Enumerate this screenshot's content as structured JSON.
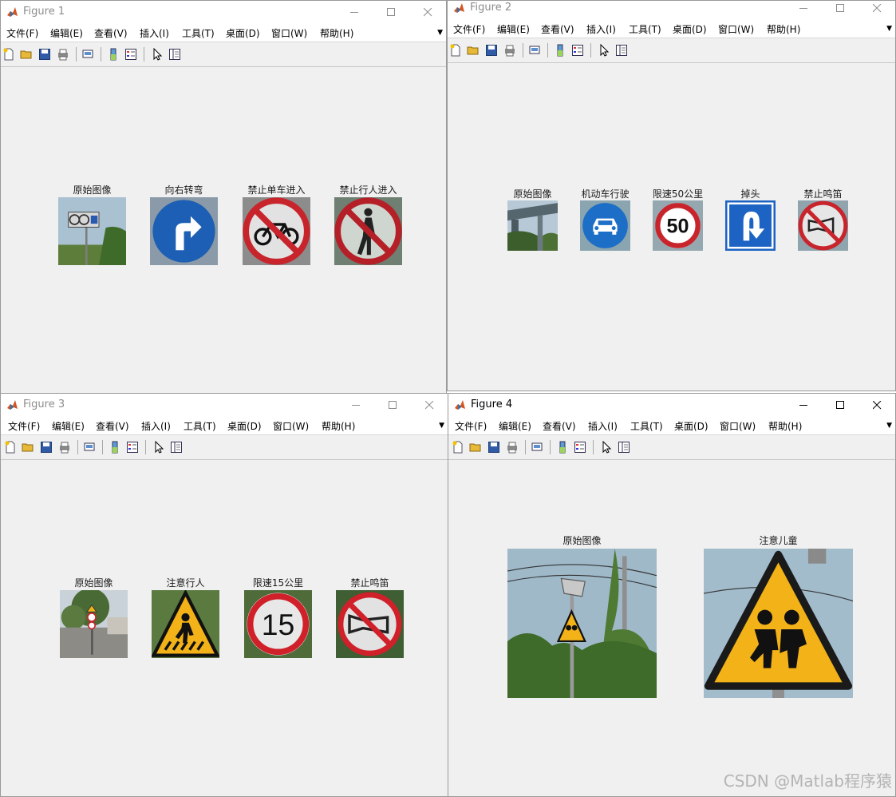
{
  "menu_labels": [
    "文件(F)",
    "编辑(E)",
    "查看(V)",
    "插入(I)",
    "工具(T)",
    "桌面(D)",
    "窗口(W)",
    "帮助(H)"
  ],
  "figures": [
    {
      "title": "Figure 1",
      "subplots": [
        "原始图像",
        "向右转弯",
        "禁止单车进入",
        "禁止行人进入"
      ]
    },
    {
      "title": "Figure 2",
      "subplots": [
        "原始图像",
        "机动车行驶",
        "限速50公里",
        "掉头",
        "禁止鸣笛"
      ]
    },
    {
      "title": "Figure 3",
      "subplots": [
        "原始图像",
        "注意行人",
        "限速15公里",
        "禁止鸣笛"
      ]
    },
    {
      "title": "Figure 4",
      "active": true,
      "subplots": [
        "原始图像",
        "注意儿童"
      ]
    }
  ],
  "sign_text": {
    "speed50": "50",
    "speed15": "15"
  },
  "watermark": "CSDN @Matlab程序猿",
  "icons": {
    "window": "matlab-logo-icon",
    "controls": [
      "minimize-icon",
      "maximize-icon",
      "close-icon"
    ],
    "toolbar": [
      "new-figure-icon",
      "open-file-icon",
      "save-icon",
      "print-icon",
      "print-preview-icon",
      "colorbar-icon",
      "legend-icon",
      "pointer-icon",
      "property-editor-icon"
    ]
  },
  "colors": {
    "window_bg": "#f0f0f0",
    "sign_blue": "#1d5fb4",
    "sign_red": "#c8242c",
    "sign_yellow": "#f2b218",
    "photo_sky": "#9fb9c9"
  }
}
